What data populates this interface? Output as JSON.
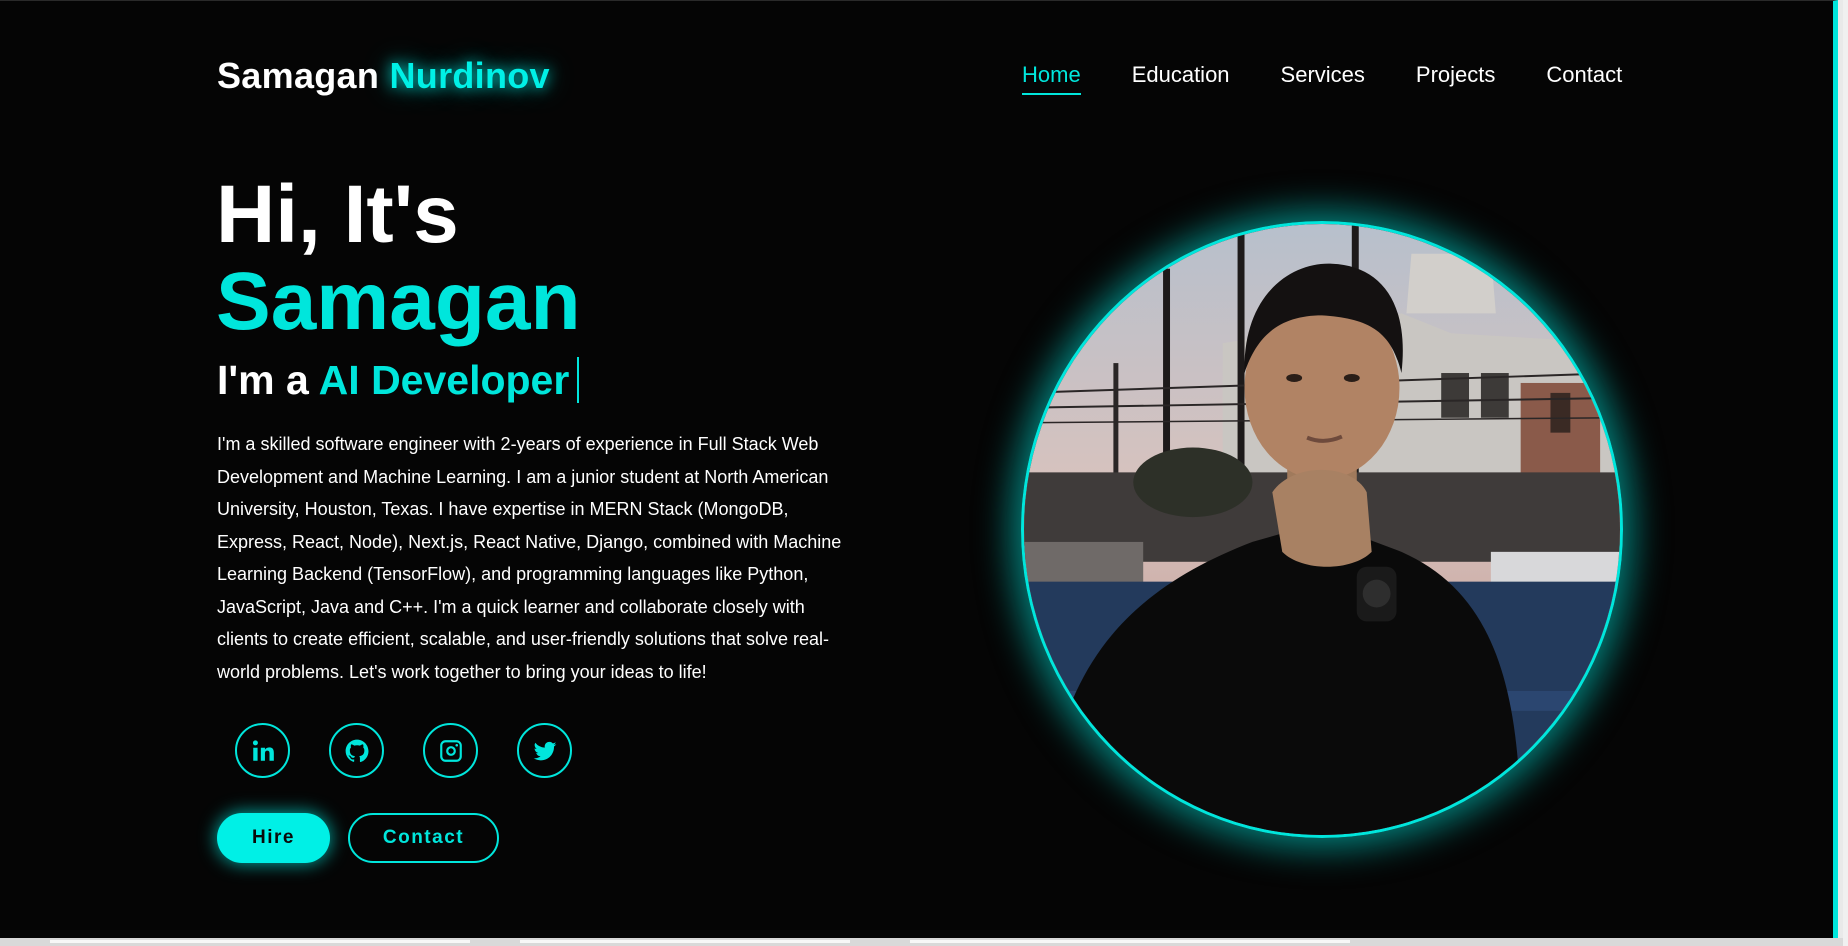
{
  "header": {
    "logo_first": "Samagan",
    "logo_last": "Nurdinov",
    "nav": [
      "Home",
      "Education",
      "Services",
      "Projects",
      "Contact"
    ],
    "active_nav": "Home"
  },
  "hero": {
    "greeting": "Hi, It's",
    "name": "Samagan",
    "role_prefix": "I'm a",
    "role": "AI Developer",
    "bio": "I'm a skilled software engineer with 2-years of experience in Full Stack Web Development and Machine Learning. I am a junior student at North American University, Houston, Texas. I have expertise in MERN Stack (MongoDB, Express, React, Node), Next.js, React Native, Django, combined with Machine Learning Backend (TensorFlow), and programming languages like Python, JavaScript, Java and C++. I'm a quick learner and collaborate closely with clients to create efficient, scalable, and user-friendly solutions that solve real-world problems. Let's work together to bring your ideas to life!",
    "hire_label": "Hire",
    "contact_label": "Contact"
  },
  "socials": [
    "linkedin-icon",
    "github-icon",
    "instagram-icon",
    "twitter-icon"
  ],
  "colors": {
    "accent": "#00e6dc",
    "background": "#050505",
    "text": "#ffffff"
  }
}
